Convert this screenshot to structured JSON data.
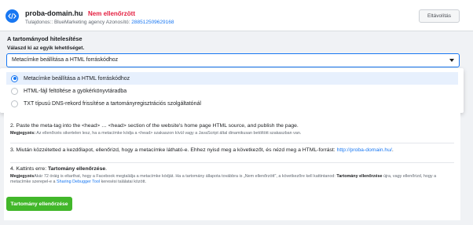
{
  "header": {
    "domain": "proba-domain.hu",
    "status": "Nem ellenőrzött",
    "owner_prefix": "Tulajdonos:: BlueMarketing agency  Azonosító: ",
    "owner_id": "288512509629168",
    "remove_label": "Eltávolítás"
  },
  "section": {
    "title": "A tartományod hitelesítése",
    "choose_label": "Válaszd ki az egyik lehetőséget."
  },
  "select": {
    "value": "Metacímke beállítása a HTML forráskódhoz",
    "options": [
      {
        "label": "Metacímke beállítása a HTML forráskódhoz",
        "selected": true
      },
      {
        "label": "HTML-fájl feltöltése a gyökérkönyvtáradba",
        "selected": false
      },
      {
        "label": "TXT típusú DNS-rekord frissítése a tartományregisztrációs szolgáltatónál",
        "selected": false
      }
    ]
  },
  "steps": {
    "step2": {
      "text": "2. Paste the meta-tag into the <head> … <head> section of the website's home page HTML source, and publish the page.",
      "note_label": "Megjegyzés:",
      "note": " Az ellenőrzés sikertelen lesz, ha a metacímke kódja a <head> szakaszon kívül vagy a JavaScript által dinamikusan betöltött szakaszban van."
    },
    "step3": {
      "text": "3. Miután közzétetted a kezdőlapot, ellenőrizd, hogy a metacímke látható-e. Ehhez nyisd meg a következőt, és nézd meg a HTML-forrást: ",
      "link": "http://proba-domain.hu/",
      "suffix": "."
    },
    "step4": {
      "prefix": "4. Kattints erre: ",
      "action": "Tartomány ellenőrzése",
      "suffix": ".",
      "note_label": "Megjegyzés",
      "note_a": "Akár 72 óráig is eltarthat, hogy a Facebook megtalálja a metacímke kódját. Ha a tartomány állapota továbbra is „Nem ellenőrzött\", a következőre kell kattintanod: ",
      "note_action": "Tartomány ellenőrzése",
      "note_b": " újra, vagy ellenőrizd, hogy a metacímke szerepel-e a ",
      "note_link": "Sharing Debugger Tool",
      "note_c": " keresési találatai között."
    }
  },
  "verify_button": "Tartomány ellenőrzése",
  "colors": {
    "accent": "#1877f2",
    "status_red": "#e41e3f",
    "button_green": "#42b72a"
  }
}
